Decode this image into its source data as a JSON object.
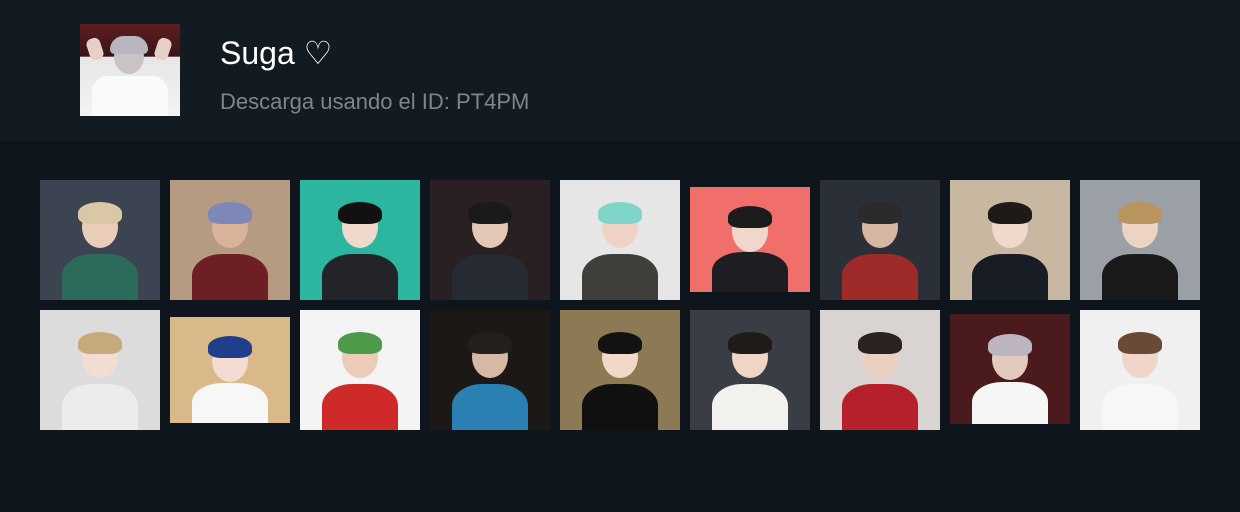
{
  "pack": {
    "title": "Suga ♡",
    "subtitle": "Descarga usando el ID: PT4PM",
    "cover_icon": "sticker-pack-cover"
  },
  "stickers": [
    {
      "icon": "sticker-apron-pose",
      "bg": "#3b4450",
      "hair": "#d9c7a6",
      "skin": "#e9cdb9",
      "body": "#2c6b5c"
    },
    {
      "icon": "sticker-desert-dance",
      "bg": "#b59b82",
      "hair": "#7e88b8",
      "skin": "#d8b39a",
      "body": "#6e1f24"
    },
    {
      "icon": "sticker-school-uniform",
      "bg": "#2cb6a0",
      "hair": "#111111",
      "skin": "#efd8cc",
      "body": "#232428"
    },
    {
      "icon": "sticker-black-jacket",
      "bg": "#2a2024",
      "hair": "#1a1a1a",
      "skin": "#e4c8b6",
      "body": "#262a33"
    },
    {
      "icon": "sticker-beanie-mint",
      "bg": "#e6e6e6",
      "hair": "#7fd6c8",
      "skin": "#eed3c4",
      "body": "#3e3e3a"
    },
    {
      "icon": "sticker-hands-face",
      "bg": "#f06f6a",
      "hair": "#1c1c1c",
      "skin": "#f1d7cb",
      "body": "#1e1e22"
    },
    {
      "icon": "sticker-street-dance",
      "bg": "#2b2f38",
      "hair": "#2a2a2a",
      "skin": "#d7b7a2",
      "body": "#9e2a2a"
    },
    {
      "icon": "sticker-glasses",
      "bg": "#c8b8a2",
      "hair": "#1e1a18",
      "skin": "#f0d9cc",
      "body": "#181c24"
    },
    {
      "icon": "sticker-blond-black",
      "bg": "#9aa0a6",
      "hair": "#b9945e",
      "skin": "#ecd3c3",
      "body": "#1a1a1a"
    },
    {
      "icon": "sticker-white-shirt-wave",
      "bg": "#dcdcdc",
      "hair": "#c7aa7c",
      "skin": "#f3ddd2",
      "body": "#ececec"
    },
    {
      "icon": "sticker-blue-hair",
      "bg": "#d9b98a",
      "hair": "#1f3f8a",
      "skin": "#f2dbd0",
      "body": "#f7f7f7"
    },
    {
      "icon": "sticker-red-dance",
      "bg": "#f4f4f4",
      "hair": "#4f9a4a",
      "skin": "#eccbb8",
      "body": "#cf2a2a"
    },
    {
      "icon": "sticker-birthday-cake",
      "bg": "#1c1815",
      "hair": "#231f1d",
      "skin": "#d7b8a4",
      "body": "#2a7fb3"
    },
    {
      "icon": "sticker-close-up",
      "bg": "#8c7a55",
      "hair": "#121212",
      "skin": "#f2d8c9",
      "body": "#101010"
    },
    {
      "icon": "sticker-white-shirt",
      "bg": "#3a3d44",
      "hair": "#1e1b19",
      "skin": "#efd5c6",
      "body": "#f3f1ee"
    },
    {
      "icon": "sticker-plaid-shirt",
      "bg": "#d9d4d2",
      "hair": "#2a2221",
      "skin": "#ebcfbf",
      "body": "#b5202a"
    },
    {
      "icon": "sticker-hands-up",
      "bg": "#4b1a1c",
      "hair": "#bcb5bf",
      "skin": "#e3cabf",
      "body": "#f6f6f6"
    },
    {
      "icon": "sticker-suspenders",
      "bg": "#f0f0f0",
      "hair": "#6a4a37",
      "skin": "#f0d6c8",
      "body": "#f7f7f7"
    }
  ]
}
